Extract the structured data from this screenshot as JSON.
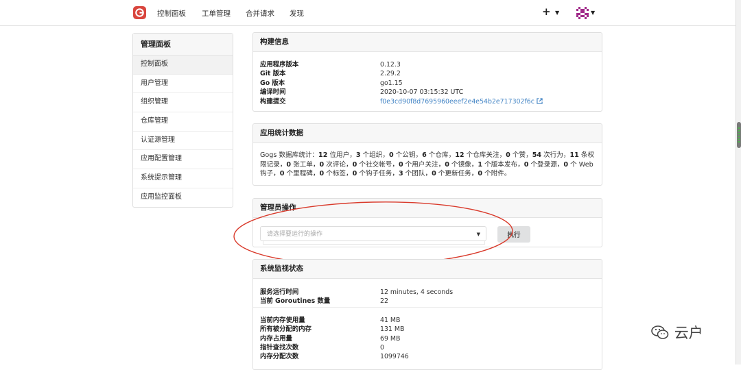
{
  "nav": {
    "items": [
      "控制面板",
      "工单管理",
      "合并请求",
      "发现"
    ],
    "plus_label": "+",
    "brand_color": "#d9453d"
  },
  "sidebar": {
    "title": "管理面板",
    "items": [
      "控制面板",
      "用户管理",
      "组织管理",
      "仓库管理",
      "认证源管理",
      "应用配置管理",
      "系统提示管理",
      "应用监控面板"
    ]
  },
  "build_info": {
    "title": "构建信息",
    "rows": [
      {
        "k": "应用程序版本",
        "v": "0.12.3"
      },
      {
        "k": "Git 版本",
        "v": "2.29.2"
      },
      {
        "k": "Go 版本",
        "v": "go1.15"
      },
      {
        "k": "编译时间",
        "v": "2020-10-07 03:15:32 UTC"
      },
      {
        "k": "构建提交",
        "v": "f0e3cd90f8d7695960eeef2e4e54b2e717302f6c"
      }
    ]
  },
  "app_stats": {
    "title": "应用统计数据",
    "lead": "Gogs 数据库统计：",
    "items": [
      {
        "n": "12",
        "t": "位用户，"
      },
      {
        "n": "3",
        "t": "个组织，"
      },
      {
        "n": "0",
        "t": "个公钥，"
      },
      {
        "n": "6",
        "t": "个仓库，"
      },
      {
        "n": "12",
        "t": "个仓库关注，"
      },
      {
        "n": "0",
        "t": "个赞，"
      },
      {
        "n": "54",
        "t": "次行为，"
      },
      {
        "n": "11",
        "t": "条权限记录，"
      },
      {
        "n": "0",
        "t": "张工单，"
      },
      {
        "n": "0",
        "t": "次评论，"
      },
      {
        "n": "0",
        "t": "个社交帐号，"
      },
      {
        "n": "0",
        "t": "个用户关注，"
      },
      {
        "n": "0",
        "t": "个镜像，"
      },
      {
        "n": "1",
        "t": "个版本发布，"
      },
      {
        "n": "0",
        "t": "个登录源，"
      },
      {
        "n": "0",
        "t": "个 Web 钩子，"
      },
      {
        "n": "0",
        "t": "个里程碑，"
      },
      {
        "n": "0",
        "t": "个标签，"
      },
      {
        "n": "0",
        "t": "个钩子任务，"
      },
      {
        "n": "3",
        "t": "个团队，"
      },
      {
        "n": "0",
        "t": "个更新任务，"
      },
      {
        "n": "0",
        "t": "个附件。"
      }
    ]
  },
  "admin_ops": {
    "title": "管理员操作",
    "select_placeholder": "请选择要运行的操作",
    "run_label": "执行"
  },
  "monitor": {
    "title": "系统监视状态",
    "rows_a": [
      {
        "k": "服务运行时间",
        "v": "12 minutes, 4 seconds"
      },
      {
        "k": "当前 Goroutines 数量",
        "v": "22"
      }
    ],
    "rows_b": [
      {
        "k": "当前内存使用量",
        "v": "41 MB"
      },
      {
        "k": "所有被分配的内存",
        "v": "131 MB"
      },
      {
        "k": "内存占用量",
        "v": "69 MB"
      },
      {
        "k": "指针查找次数",
        "v": "0"
      },
      {
        "k": "内存分配次数",
        "v": "1099746"
      }
    ]
  },
  "watermark": "云户"
}
